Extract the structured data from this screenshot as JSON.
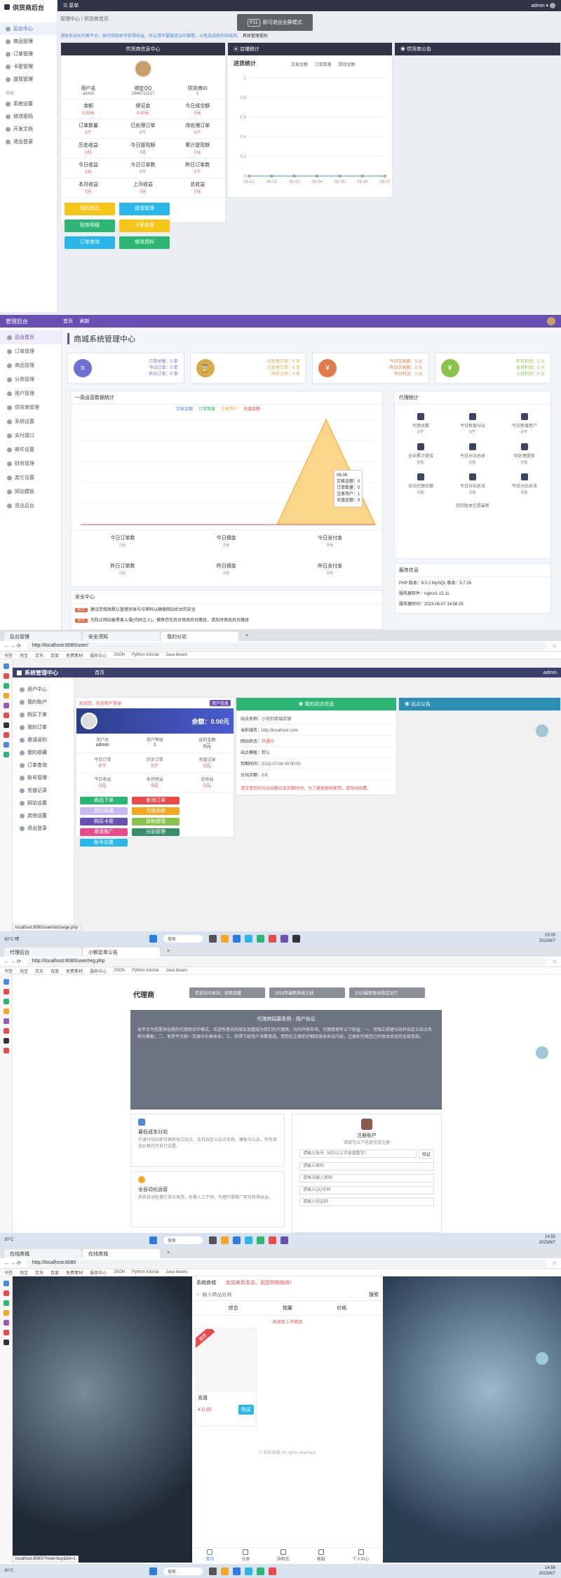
{
  "s1": {
    "brand": "供货商后台",
    "topbar_left": "菜单",
    "user": "admin",
    "breadcrumb": [
      "管理中心",
      "供货商首页"
    ],
    "toast_key": "F11",
    "toast_text": "即可退出全屏模式",
    "notice": "请联系站长代售平台，做代销商即可获得收益，所以请不要做违法的事情，以免造成损失和麻烦。",
    "notice_link": "具体管理规则",
    "sidebar_groups": [
      {
        "title": "",
        "items": [
          "后台中心",
          "商品管理",
          "订单管理",
          "卡密管理",
          "提现管理"
        ]
      },
      {
        "title": "其他",
        "items": [
          "系统设置",
          "修改密码",
          "开发文档",
          "退出登录"
        ]
      }
    ],
    "panels": {
      "info": "供货商信息中心",
      "chart": "店铺统计",
      "notice": "供货商公告"
    },
    "info_kv": [
      [
        "用户名",
        "admin"
      ],
      [
        "绑定QQ",
        "1644713117"
      ],
      [
        "供货商ID",
        "1"
      ],
      [
        "余额",
        "0.00元"
      ],
      [
        "保证金",
        "0.00元"
      ],
      [
        "今日成交额",
        "0元"
      ],
      [
        "订单数量",
        "0个"
      ],
      [
        "已处理订单",
        "0个"
      ],
      [
        "待处理订单",
        "0个"
      ],
      [
        "历史收益",
        "0元"
      ],
      [
        "今日提现额",
        "0元"
      ],
      [
        "累计提现额",
        "0元"
      ],
      [
        "今日收益",
        "0元"
      ],
      [
        "今日订单数",
        "0个"
      ],
      [
        "昨日订单数",
        "0个"
      ],
      [
        "本月收益",
        "0元"
      ],
      [
        "上月收益",
        "0元"
      ],
      [
        "总收益",
        "0元"
      ]
    ],
    "buttons": [
      "我的商品",
      "提现管理",
      "财务明细",
      "卡密查看",
      "订单查询",
      "修改资料"
    ],
    "chart_title": "进货统计",
    "chart_legend": [
      "交易金额",
      "订单数量",
      "提现金额"
    ],
    "chart_x": [
      "06-01",
      "06-02",
      "06-03",
      "06-04",
      "06-05",
      "06-06",
      "06-07"
    ],
    "chart_y": [
      "1",
      "0.8",
      "0.6",
      "0.4",
      "0.2",
      "0"
    ]
  },
  "s2": {
    "brand": "管理后台",
    "top_items": [
      "首页",
      "刷新"
    ],
    "title": "商城系统管理中心",
    "sidebar": [
      "后台首页",
      "订单管理",
      "商品管理",
      "分类管理",
      "用户管理",
      "供货商管理",
      "系统设置",
      "支付接口",
      "邮件设置",
      "财务管理",
      "其它设置",
      "网站模板",
      "退出后台"
    ],
    "stat_cards": [
      {
        "lines": [
          "订单总量：0 单",
          "今日订单：0 单",
          "昨日订单：0 单"
        ],
        "color": "#6c6fd3",
        "glyph": "≡"
      },
      {
        "lines": [
          "待处理订单：0 单",
          "已处理订单：0 单",
          "失败订单：0 单"
        ],
        "color": "#d9a94a",
        "glyph": "⌛"
      },
      {
        "lines": [
          "今日交易额：0 元",
          "昨日交易额：0 元",
          "今日利润：0 元"
        ],
        "color": "#e07b4b",
        "glyph": "¥"
      },
      {
        "lines": [
          "昨日利润：0 元",
          "本月利润：0 元",
          "上月利润：0 元"
        ],
        "color": "#8bc34a",
        "glyph": "¥"
      }
    ],
    "chart_panel_title": "一周运营数据统计",
    "legend": [
      "交易金额",
      "订单数量",
      "注册用户",
      "充值金额"
    ],
    "tooltip": {
      "date": "06-06",
      "rows": [
        "交易金额：0",
        "订单数量：0",
        "注册用户：1",
        "充值金额：0"
      ]
    },
    "mini_stats": [
      [
        "今日订单数",
        "0元"
      ],
      [
        "今日佣金",
        "0元"
      ],
      [
        "今日支付金",
        "0元"
      ],
      [
        "昨日订单数",
        "0元"
      ],
      [
        "昨日佣金",
        "0元"
      ],
      [
        "昨日支付金",
        "0元"
      ]
    ],
    "right_panel_title": "代理统计",
    "right_stats": [
      [
        "代理总数",
        "0个"
      ],
      [
        "今日新增分站",
        "0个"
      ],
      [
        "今日新增用户",
        "0个"
      ],
      [
        "全站累计提成",
        "0元"
      ],
      [
        "今日分站总收",
        "0元"
      ],
      [
        "待处理提现",
        "0元"
      ],
      [
        "全站代理余额",
        "0元"
      ],
      [
        "今日分站总消",
        "0元"
      ],
      [
        "今日分站总消",
        "0元"
      ]
    ],
    "right_note": "您的版本已是最新",
    "server_title": "服务信息",
    "server_rows": [
      "PHP 版本：8.0.2    MySQL 版本：5.7.26",
      "服务器软件：nginx/1.15.11",
      "服务器时间：2023-06-07 14:56:29"
    ],
    "security_title": "安全中心",
    "security_rows": [
      "建议您修改默认管理员账号与密码以确保网站后台的安全",
      "为防止网站被黑客入侵(代码注入)，推荐您在后台修改后台路径，请及时修改后台路径"
    ]
  },
  "s3": {
    "tabs": [
      "后台管理",
      "安全须知",
      "我的分站",
      "+"
    ],
    "url": "http://localhost:8080/user/",
    "bookmarks": [
      "书签",
      "淘宝",
      "京东",
      "百度",
      "免费素材",
      "服务中心",
      "JSON",
      "Python tutorial",
      "Java beans"
    ],
    "brand": "系统管理中心",
    "top_menu": "首页",
    "user": "admin",
    "sidebar": [
      "用户中心",
      "我的账户",
      "购买下单",
      "我的订单",
      "邀请返利",
      "我的收藏",
      "订单查询",
      "账号管理",
      "充值记录",
      "网站设置",
      "其他设置",
      "退出登录"
    ],
    "user_card": {
      "tag": "用户信息",
      "greeting": "欢迎您，欢迎用户登录",
      "balance_label": "余额：",
      "balance": "0.00元",
      "name_label": "用户名",
      "name": "admin",
      "level_label": "用户等级",
      "level": "1",
      "rebate_label": "返利金额",
      "rebate": "0元",
      "kv": [
        [
          "今日订单",
          "0个"
        ],
        [
          "历史订单",
          "0个"
        ],
        [
          "充值记录",
          "0元"
        ],
        [
          "今日收益",
          "0元"
        ],
        [
          "本月收益",
          "0元"
        ],
        [
          "总收益",
          "0元"
        ]
      ]
    },
    "buttons": [
      "商品下单",
      "查询订单",
      "我的收藏",
      "充值余额",
      "购买卡密",
      "自助提现",
      "邀请推广",
      "分站管理",
      "账号设置"
    ],
    "site_panel": {
      "title": "我的站点信息",
      "rows": [
        [
          "站点名称：",
          "小天的商城店铺"
        ],
        [
          "当前域名：",
          "http://localhost.com"
        ],
        [
          "网站状态：",
          "开通中"
        ],
        [
          "站点模板：",
          "默认"
        ],
        [
          "到期时间：",
          "2023-07-08 00:00:00"
        ],
        [
          "分站余额：",
          "0元"
        ]
      ],
      "warn": "请注意您的分站余额以及到期时间，为了避免影响使用，请及时续费。"
    },
    "notice_title": "站点公告",
    "status_url": "localhost:8080/user/recharge.php",
    "taskbar_temp": "30°C",
    "taskbar_weather": "晴",
    "clock": "15:00",
    "date": "2023/6/7"
  },
  "s4": {
    "tabs": [
      "代理后台",
      "小额定单公告",
      "+"
    ],
    "url": "http://localhost:8080/user/reg.php",
    "logo": "代理商",
    "marquee": [
      "欢迎访问本站，招商加盟",
      "2023年最新系统上线",
      "2023最新版本稳定运行"
    ],
    "notice_title": "代理商招募条例 - 用户协议",
    "notice_text": "本平台为您提供优质的代理商合作模式，欢迎有意向的朋友加盟成为我们的代理商，共同开拓市场。代理商享有以下权益：一、可独立搭建分站并自定义站点名称与模板；二、享受平台统一货源与价格体系；三、获得下级用户消费提成。请您在注册前仔细阅读本协议内容，注册即代表您已同意本协议的全部条款。",
    "card_a_title": "最低成本分站",
    "card_a_text": "开通分站后即可拥有独立站点，支持自定义站点名称、模板与公告，所有商品价格均可自行设置。",
    "card_b_title": "全自动化运营",
    "card_b_text": "系统自动处理订单与发货，无需人工干预，代理只需推广即可获得收益。",
    "reg_title": "注册账户",
    "reg_sub": "请填写以下信息完成注册",
    "fields": [
      "请输入账号（6位以上字母或数字）",
      "请输入密码",
      "请再次输入密码",
      "请输入QQ号码",
      "请输入验证码"
    ],
    "code_btn": "验证",
    "taskbar_temp": "30°C",
    "clock": "14:55",
    "date": "2023/6/7"
  },
  "s5": {
    "tabs": [
      "在线商城",
      "在线商城",
      "+"
    ],
    "url": "http://localhost:8080",
    "shop_name": "系统商城",
    "welcome": "欢迎来到本站，祝您购物愉快！",
    "search_placeholder": "输入商品名称",
    "search_btn": "搜索",
    "sorts": [
      "综合",
      "销量",
      "价格"
    ],
    "count_text": "共找到 1 件商品",
    "product_name": "充值",
    "product_price": "¥ 0.00",
    "buy_btn": "购买",
    "badge": "推荐",
    "footer": "© 系统商城 All rights reserved.",
    "nav": [
      "首页",
      "分类",
      "购物车",
      "客服",
      "个人中心"
    ],
    "status_url": "localhost:8080/?mod=buy&tid=1",
    "clock": "14:56",
    "date": "2023/6/7"
  },
  "colors": {
    "brand_purple": "#6a4fb3",
    "dark": "#2f3447",
    "yellow": "#f5c518",
    "blue": "#29b6e8",
    "green": "#2bb673",
    "red": "#e94b4b"
  }
}
